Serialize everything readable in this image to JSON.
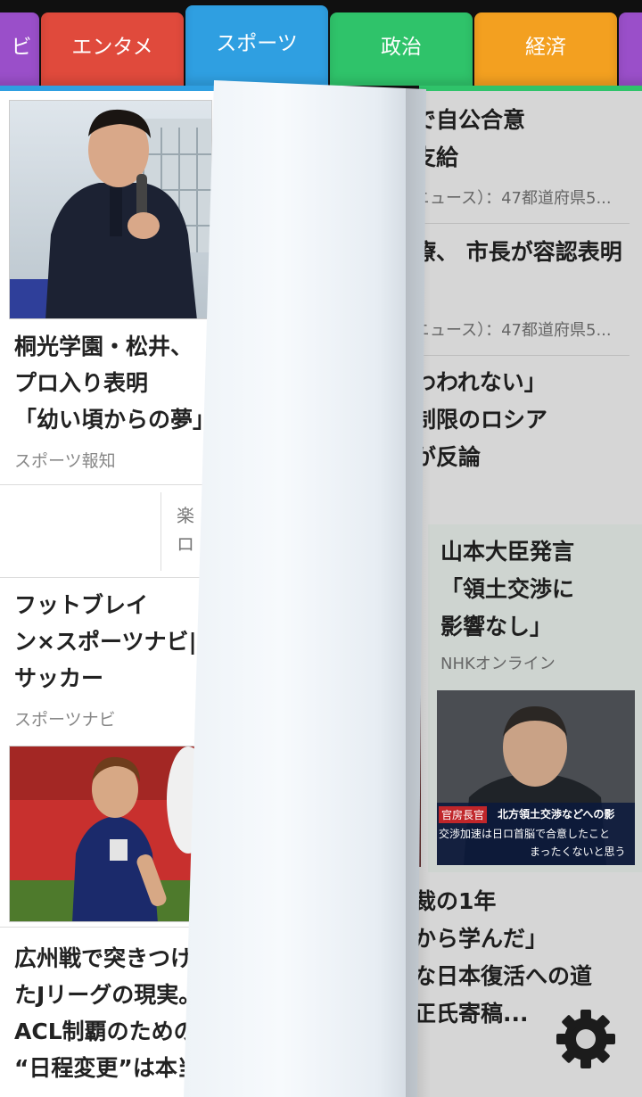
{
  "tabs": [
    {
      "label": "ビ",
      "color": "#9a4fc9"
    },
    {
      "label": "エンタメ",
      "color": "#e04a3c"
    },
    {
      "label": "スポーツ",
      "color": "#2f9fe1",
      "active": true
    },
    {
      "label": "政治",
      "color": "#2fc36a"
    },
    {
      "label": "経済",
      "color": "#f3a020"
    }
  ],
  "left": {
    "card1": {
      "lines": [
        "桐光学園・松井、",
        "プロ入り表明",
        "「幼い頃からの夢」"
      ],
      "source": "スポーツ報知"
    },
    "ad": {
      "lines": [
        "楽",
        "ロ"
      ]
    },
    "card2": {
      "lines": [
        "フットブレイ",
        "ン×スポーツナビ|",
        "サッカー"
      ],
      "source": "スポーツナビ"
    },
    "card3": {
      "lines": [
        "広州戦で突きつけ",
        "たJリーグの現実。",
        "ACL制覇のための",
        "“日程変更”は本当"
      ]
    }
  },
  "right": {
    "item1": {
      "lines": [
        "で自公合意",
        "支給"
      ],
      "meta": "ニュース）：47都道府県5..."
    },
    "item2": {
      "lines": [
        "療、 市長が容認表明"
      ],
      "meta": "ニュース）：47都道府県5..."
    },
    "item3": {
      "lines": [
        "わわれない」",
        "制限のロシア",
        "が反論"
      ]
    },
    "item4": {
      "lines": [
        "山本大臣発言",
        "「領土交渉に",
        "影響なし」"
      ],
      "meta": "NHKオンライン",
      "photo_caption": [
        "官房長官",
        "北方領土交渉などへの影",
        "交渉加速は日ロ首脳で合意したこと",
        "まったくないと思う"
      ]
    },
    "item5": {
      "lines": [
        "裁の1年",
        "から学んだ」",
        "な日本復活への道",
        "正氏寄稿..."
      ]
    }
  },
  "settings": {
    "icon": "gear-icon"
  }
}
